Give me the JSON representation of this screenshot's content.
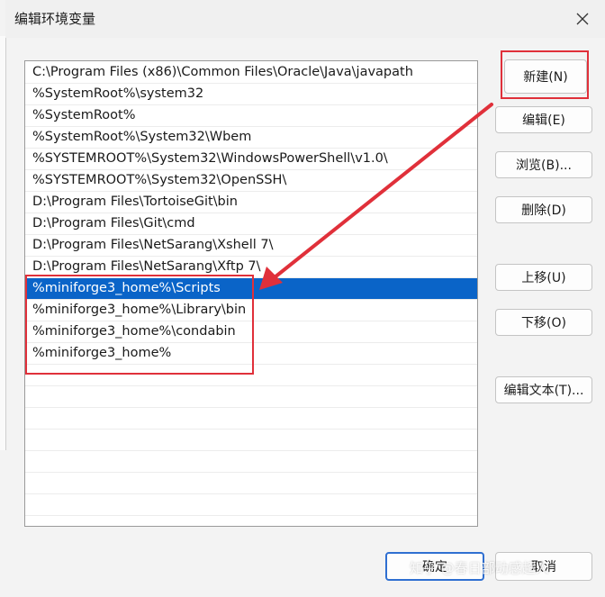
{
  "window": {
    "title": "编辑环境变量"
  },
  "paths": [
    "C:\\Program Files (x86)\\Common Files\\Oracle\\Java\\javapath",
    "%SystemRoot%\\system32",
    "%SystemRoot%",
    "%SystemRoot%\\System32\\Wbem",
    "%SYSTEMROOT%\\System32\\WindowsPowerShell\\v1.0\\",
    "%SYSTEMROOT%\\System32\\OpenSSH\\",
    "D:\\Program Files\\TortoiseGit\\bin",
    "D:\\Program Files\\Git\\cmd",
    "D:\\Program Files\\NetSarang\\Xshell 7\\",
    "D:\\Program Files\\NetSarang\\Xftp 7\\",
    "%miniforge3_home%\\Scripts",
    "%miniforge3_home%\\Library\\bin",
    "%miniforge3_home%\\condabin",
    "%miniforge3_home%"
  ],
  "selected_index": 10,
  "buttons": {
    "new": "新建(N)",
    "edit": "编辑(E)",
    "browse": "浏览(B)...",
    "delete": "删除(D)",
    "move_up": "上移(U)",
    "move_down": "下移(O)",
    "edit_text": "编辑文本(T)...",
    "ok": "确定",
    "cancel": "取消"
  },
  "watermark": "知乎 @春日部动感超人",
  "colors": {
    "selection": "#0a64c8",
    "annotation": "#e0303a"
  }
}
